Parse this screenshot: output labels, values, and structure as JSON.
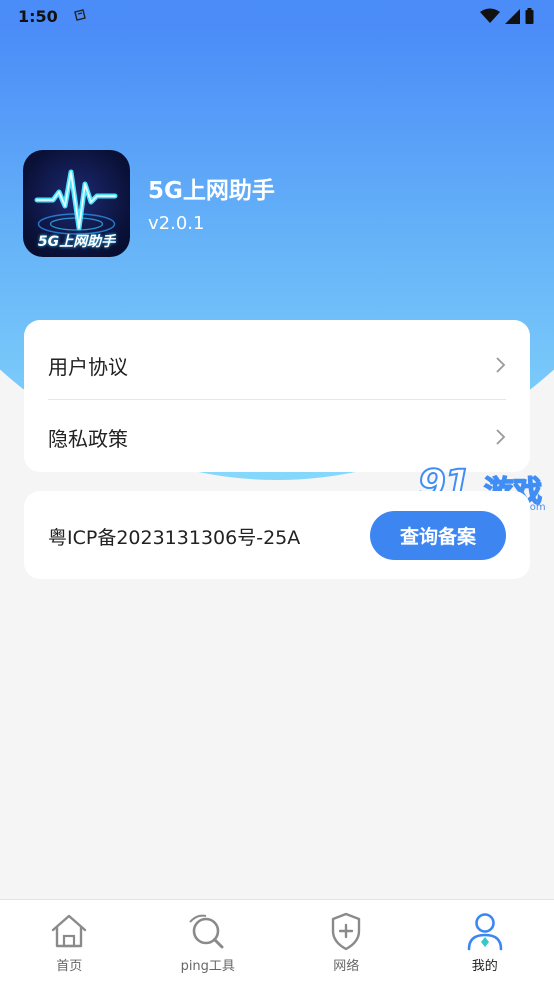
{
  "status_bar": {
    "time": "1:50"
  },
  "app": {
    "icon_label": "5G上网助手",
    "name": "5G上网助手",
    "version": "v2.0.1"
  },
  "menu": {
    "items": [
      {
        "label": "用户协议"
      },
      {
        "label": "隐私政策"
      }
    ]
  },
  "icp": {
    "text": "粤ICP备2023131306号-25A",
    "button_label": "查询备案"
  },
  "watermark": {
    "number": "91",
    "text": "游戏",
    "url": "91danji.com"
  },
  "bottom_nav": {
    "items": [
      {
        "label": "首页",
        "icon": "home-icon",
        "active": false
      },
      {
        "label": "ping工具",
        "icon": "search-icon",
        "active": false
      },
      {
        "label": "网络",
        "icon": "shield-plus-icon",
        "active": false
      },
      {
        "label": "我的",
        "icon": "user-icon",
        "active": true
      }
    ]
  },
  "colors": {
    "accent": "#3d86f2",
    "gradient_top": "#3f7ff7",
    "gradient_bottom": "#86d8fb",
    "background": "#f5f5f5"
  }
}
